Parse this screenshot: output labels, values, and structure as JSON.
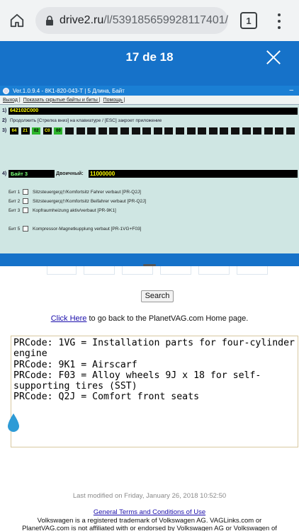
{
  "browser": {
    "url_host": "drive2.ru",
    "url_path": "/l/539185659928117401/",
    "tab_count": "1"
  },
  "viewer": {
    "counter": "17 de 18"
  },
  "vcds": {
    "title": "Ver.1.0.9.4 -   8K1-820-043-T | 5 Длина, Байт",
    "menu": [
      "Выход |",
      "Показать скрытые байты и биты |",
      "Помощь |"
    ],
    "row1_num": "1)",
    "row1_value": "642102C000",
    "row2_num": "2)",
    "row2_text": "Продолжить [Стрелка вниз] на клавиатуре / [ESC] закроет приложение",
    "row3_num": "3)",
    "bytes": [
      "64",
      "21",
      "02",
      "C0",
      "00"
    ],
    "row4_num": "4)",
    "byte_label": "Байт 3",
    "binary_label": "Двоичный:",
    "binary_value": "11000000",
    "bits": [
      {
        "label": "Бит 1",
        "text": "Sitzsteuergerд†/Komfortsitz Fahrer verbaut [PR-Q2J]"
      },
      {
        "label": "Бит 2",
        "text": "Sitzsteuergerд†/Komfortsitz Beifahrer verbaut [PR-Q2J]"
      },
      {
        "label": "Бит 3",
        "text": "Kopfraumheizung aktiv/verbaut [PR-9K1]"
      },
      {
        "label": "Бит 5",
        "text": "Kompressor-Magnetkupplung verbaut [PR-1VG+F03]"
      }
    ]
  },
  "page": {
    "search_label": "Search",
    "click_here": "Click Here",
    "click_rest": " to go back to the PlanetVAG.com Home page.",
    "prcodes": "PRCode: 1VG = Installation parts for four-cylinder engine\nPRCode: 9K1 = Airscarf\nPRCode: F03 = Alloy wheels 9J x 18 for self-supporting tires (SST)\nPRCode: Q2J = Comfort front seats",
    "last_modified": "Last modified on Friday, January 26, 2018 10:52:50",
    "terms": "General Terms and Conditions of Use",
    "vw_line1": "Volkswagen is a registered trademark of Volkswagen AG.  VAGLinks.com or",
    "vw_line2": "PlanetVAG.com is not affiliated with or endorsed by Volkswagen AG or Volkswagen of"
  }
}
